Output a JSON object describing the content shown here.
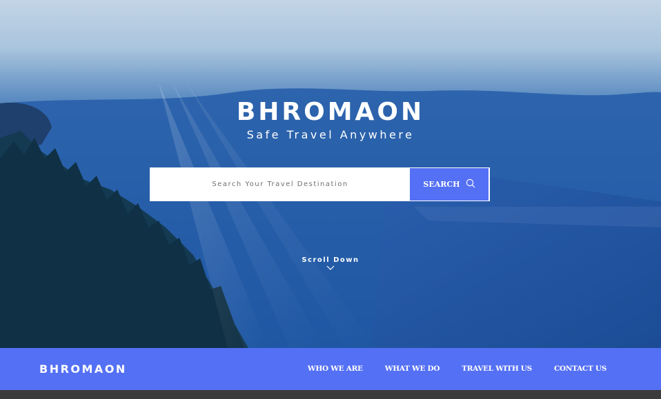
{
  "hero": {
    "title": "BHROMAON",
    "subtitle": "Safe Travel Anywhere",
    "search": {
      "placeholder": "Search Your Travel Destination",
      "button_label": "SEARCH",
      "button_icon": "search-icon"
    },
    "scroll_label": "Scroll Down",
    "scroll_icon": "chevron-down-icon"
  },
  "navbar": {
    "brand": "BHROMAON",
    "links": [
      {
        "label": "WHO WE ARE"
      },
      {
        "label": "WHAT WE DO"
      },
      {
        "label": "TRAVEL WITH US"
      },
      {
        "label": "CONTACT US"
      }
    ]
  },
  "colors": {
    "accent": "#5470f4",
    "footer_strip": "#3b3b3b"
  }
}
